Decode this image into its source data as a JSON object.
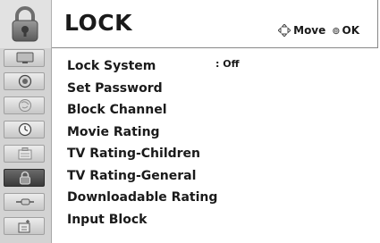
{
  "header": {
    "title": "LOCK",
    "hint_move": "Move",
    "hint_ok": "OK",
    "icon": "lock-icon"
  },
  "sidebar": {
    "items": [
      {
        "icon": "picture-icon"
      },
      {
        "icon": "audio-icon"
      },
      {
        "icon": "channel-icon"
      },
      {
        "icon": "time-icon"
      },
      {
        "icon": "option-icon"
      },
      {
        "icon": "lock-icon",
        "active": true
      },
      {
        "icon": "input-icon"
      },
      {
        "icon": "usb-icon"
      }
    ]
  },
  "menu": {
    "items": [
      {
        "label": "Lock System",
        "value": ": Off"
      },
      {
        "label": "Set Password"
      },
      {
        "label": "Block Channel"
      },
      {
        "label": "Movie Rating"
      },
      {
        "label": "TV Rating-Children"
      },
      {
        "label": "TV Rating-General"
      },
      {
        "label": "Downloadable Rating"
      },
      {
        "label": "Input Block"
      }
    ]
  }
}
